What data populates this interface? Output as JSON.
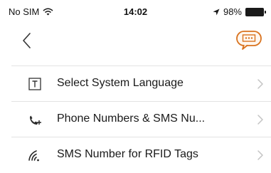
{
  "status_bar": {
    "carrier": "No SIM",
    "time": "14:02",
    "battery": "98%",
    "icons": [
      "wifi-icon",
      "location-arrow-icon",
      "battery-icon"
    ]
  },
  "nav": {
    "back_icon": "chevron-left-icon",
    "chat_icon": "chat-bubble-icon",
    "accent_color": "#d9731f"
  },
  "menu": {
    "items": [
      {
        "label": "Select System Language",
        "icon": "text-box-icon"
      },
      {
        "label": "Phone Numbers & SMS Nu...",
        "icon": "phone-plus-icon"
      },
      {
        "label": "SMS Number for RFID Tags",
        "icon": "rfid-signal-icon"
      }
    ]
  }
}
